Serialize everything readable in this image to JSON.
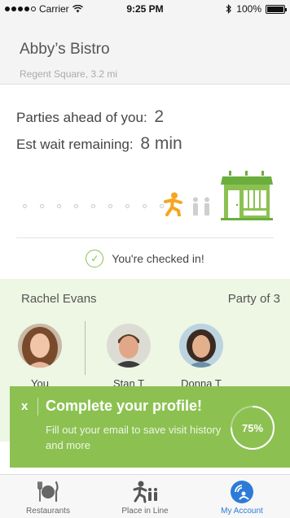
{
  "status_bar": {
    "carrier": "Carrier",
    "time": "9:25 PM",
    "battery": "100%"
  },
  "restaurant": {
    "name": "Abby’s Bistro",
    "location": "Regent Square, 3.2 mi"
  },
  "wait": {
    "parties_label": "Parties ahead of you:",
    "parties_value": "2",
    "wait_label": "Est wait remaining:",
    "wait_value": "8 min"
  },
  "progress_steps_remaining": 9,
  "checked_in_text": "You're checked in!",
  "party": {
    "name": "Rachel Evans",
    "size_label": "Party of 3",
    "members": [
      {
        "name": "You"
      },
      {
        "name": "Stan T"
      },
      {
        "name": "Donna T"
      }
    ]
  },
  "profile_banner": {
    "close": "x",
    "title": "Complete your profile!",
    "text": "Fill out your email to save visit history and more",
    "progress_label": "75%",
    "progress_fraction": 0.75
  },
  "tabs": [
    {
      "label": "Restaurants",
      "icon": "plate-fork-knife-icon"
    },
    {
      "label": "Place in Line",
      "icon": "person-in-line-icon"
    },
    {
      "label": "My Account",
      "icon": "account-icon"
    }
  ],
  "colors": {
    "accent_green": "#8cc152",
    "accent_orange": "#f5a623",
    "active_blue": "#2c7bd8"
  }
}
